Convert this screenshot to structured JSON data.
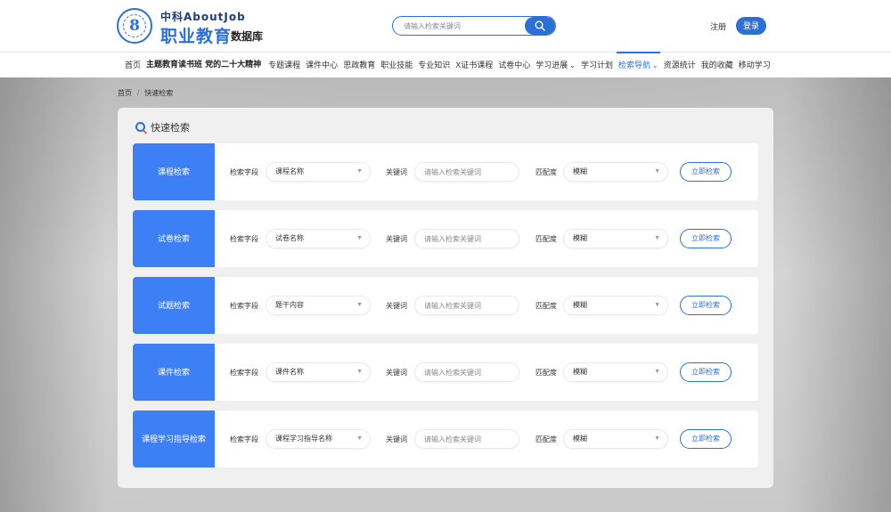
{
  "header": {
    "logo_top": "中科AboutJob",
    "logo_main": "职业教育",
    "logo_sub": "数据库",
    "logo_glyph": "8",
    "search_placeholder": "请输入检索关键词",
    "register": "注册",
    "login": "登录"
  },
  "nav": {
    "items": [
      {
        "label": "首页"
      },
      {
        "label": "主题教育读书班 党的二十大精神"
      },
      {
        "label": "专题课程"
      },
      {
        "label": "课件中心"
      },
      {
        "label": "思政教育"
      },
      {
        "label": "职业技能"
      },
      {
        "label": "专业知识"
      },
      {
        "label": "X证书课程"
      },
      {
        "label": "试卷中心"
      },
      {
        "label": "学习进展"
      },
      {
        "label": "学习计划"
      },
      {
        "label": "检索导航"
      },
      {
        "label": "资源统计"
      },
      {
        "label": "我的收藏"
      },
      {
        "label": "移动学习"
      }
    ],
    "active": "检索导航"
  },
  "breadcrumb": {
    "home": "首页",
    "sep": "/",
    "current": "快速检索"
  },
  "panel": {
    "title": "快速检索",
    "field_label": "检索字段",
    "keyword_label": "关键词",
    "keyword_placeholder": "请输入检索关键词",
    "match_label": "匹配度",
    "match_value": "模糊",
    "button": "立即检索",
    "rows": [
      {
        "category": "课程检索",
        "field_value": "课程名称"
      },
      {
        "category": "试卷检索",
        "field_value": "试卷名称"
      },
      {
        "category": "试题检索",
        "field_value": "题干内容"
      },
      {
        "category": "课件检索",
        "field_value": "课件名称"
      },
      {
        "category": "课程学习指导检索",
        "field_value": "课程学习指导名称"
      }
    ]
  },
  "colors": {
    "accent": "#2e6fd6",
    "row_label_bg": "#3d80f5"
  }
}
